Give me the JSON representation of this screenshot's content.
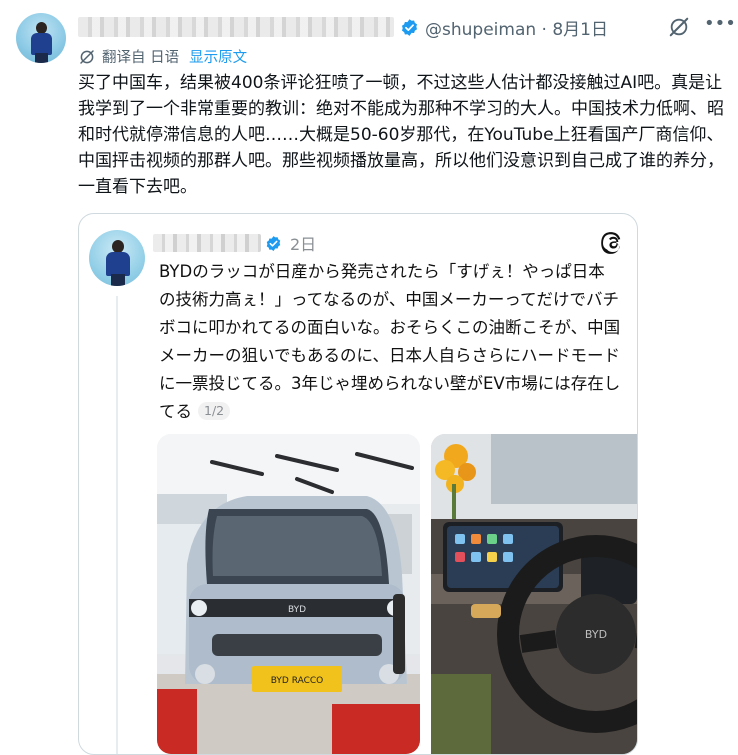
{
  "tweet": {
    "handle": "@shupeiman",
    "separator": "·",
    "date": "8月1日",
    "translated_from": "翻译自 日语",
    "show_original": "显示原文",
    "text": "买了中国车，结果被400条评论狂喷了一顿，不过这些人估计都没接触过AI吧。真是让我学到了一个非常重要的教训：绝对不能成为那种不学习的大人。中国技术力低啊、昭和时代就停滞信息的人吧……大概是50-60岁那代，在YouTube上狂看国产厂商信仰、中国抨击视频的那群人吧。那些视频播放量高，所以他们没意识到自己成了谁的养分，一直看下去吧。"
  },
  "quoted_post": {
    "date": "2日",
    "text": "BYDのラッコが日産から発売されたら「すげぇ！やっぱ日本の技術力高ぇ！」ってなるのが、中国メーカーってだけでバチボコに叩かれてるの面白いな。おそらくこの油断こそが、中国メーカーの狙いでもあるのに、日本人自らさらにハードモードに一票投じてる。3年じゃ埋められない壁がEV市場には存在してる",
    "page_indicator": "1/2",
    "photo_1": {
      "plate_text": "BYD RACCO",
      "grille_text": "BYD"
    },
    "photo_2": {
      "wheel_text": "BYD"
    }
  },
  "icons": {
    "verified": "verified-badge-icon",
    "grok": "grok-icon",
    "more": "more-icon",
    "translate": "translate-icon",
    "threads": "threads-logo-icon"
  },
  "colors": {
    "link": "#1d9bf0",
    "muted": "#536471",
    "border": "#cfd9de"
  }
}
